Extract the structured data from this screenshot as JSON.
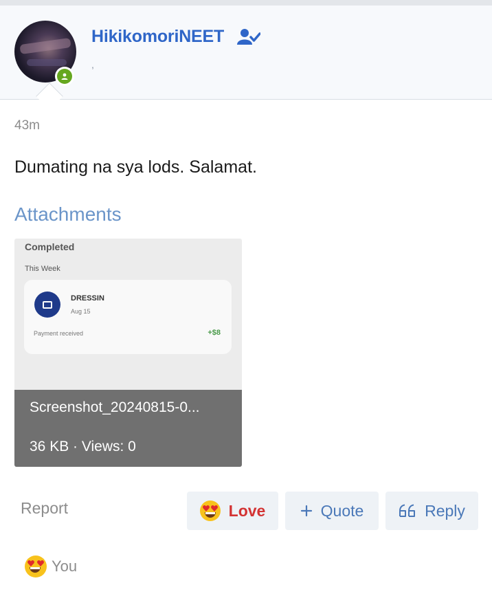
{
  "post": {
    "author": "HikikomoriNEET",
    "subtitle": ",",
    "time": "43m",
    "body": "Dumating na sya lods. Salamat."
  },
  "attachments": {
    "title": "Attachments",
    "items": [
      {
        "file_name": "Screenshot_20240815-0...",
        "meta": "36 KB · Views: 0",
        "thumbnail": {
          "heading": "Completed",
          "subheading": "This Week",
          "merchant": "DRESSIN",
          "date": "Aug 15",
          "status": "Payment received",
          "amount": "+$8"
        }
      }
    ]
  },
  "actions": {
    "report": "Report",
    "love": "Love",
    "quote": "Quote",
    "reply": "Reply"
  },
  "reactions": {
    "user": "You",
    "icon": "heart-eyes-emoji"
  },
  "colors": {
    "username": "#2f66c8",
    "love": "#d33333",
    "link": "#4a78b8",
    "online": "#65a71f"
  }
}
